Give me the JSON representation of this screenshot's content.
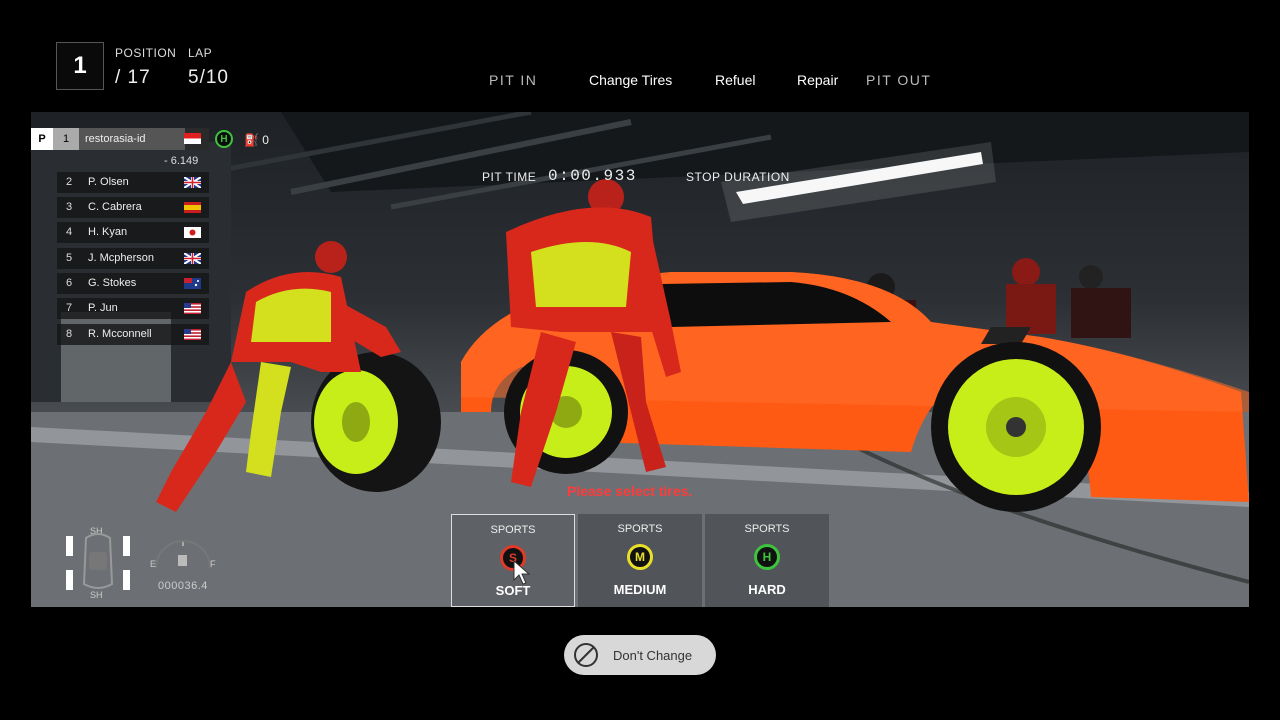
{
  "header": {
    "position": "1",
    "position_label": "POSITION",
    "position_total": "/ 17",
    "lap_label": "LAP",
    "lap_value": "5/10"
  },
  "pit_menu": {
    "pit_in": "PIT IN",
    "change_tires": "Change Tires",
    "refuel": "Refuel",
    "repair": "Repair",
    "pit_out": "PIT OUT"
  },
  "standings": {
    "player": {
      "tag": "P",
      "pos": "1",
      "name": "restorasia-id",
      "gap": "- 6.149",
      "tire": "H",
      "fuel": "0"
    },
    "rows": [
      {
        "pos": "2",
        "name": "P. Olsen"
      },
      {
        "pos": "3",
        "name": "C. Cabrera"
      },
      {
        "pos": "4",
        "name": "H. Kyan"
      },
      {
        "pos": "5",
        "name": "J. Mcpherson"
      },
      {
        "pos": "6",
        "name": "G. Stokes"
      },
      {
        "pos": "7",
        "name": "P. Jun"
      },
      {
        "pos": "8",
        "name": "R. Mcconnell"
      }
    ]
  },
  "pit_timer": {
    "label": "PIT TIME",
    "value": "0:00.933",
    "stop_label": "STOP DURATION"
  },
  "prompt": "Please select tires.",
  "tires": [
    {
      "category": "SPORTS",
      "letter": "S",
      "name": "SOFT",
      "color": "#e03a2a"
    },
    {
      "category": "SPORTS",
      "letter": "M",
      "name": "MEDIUM",
      "color": "#e8e02a"
    },
    {
      "category": "SPORTS",
      "letter": "H",
      "name": "HARD",
      "color": "#3cc43c"
    }
  ],
  "hud": {
    "sh_top": "SH",
    "sh_bottom": "SH",
    "gauge_e": "E",
    "gauge_f": "F",
    "odometer": "000036.4"
  },
  "dont_change": "Don't Change",
  "colors": {
    "car": "#ff5a14",
    "wheel": "#c8ee1a",
    "suit_red": "#d8281c",
    "suit_yellow": "#d4e01e"
  }
}
